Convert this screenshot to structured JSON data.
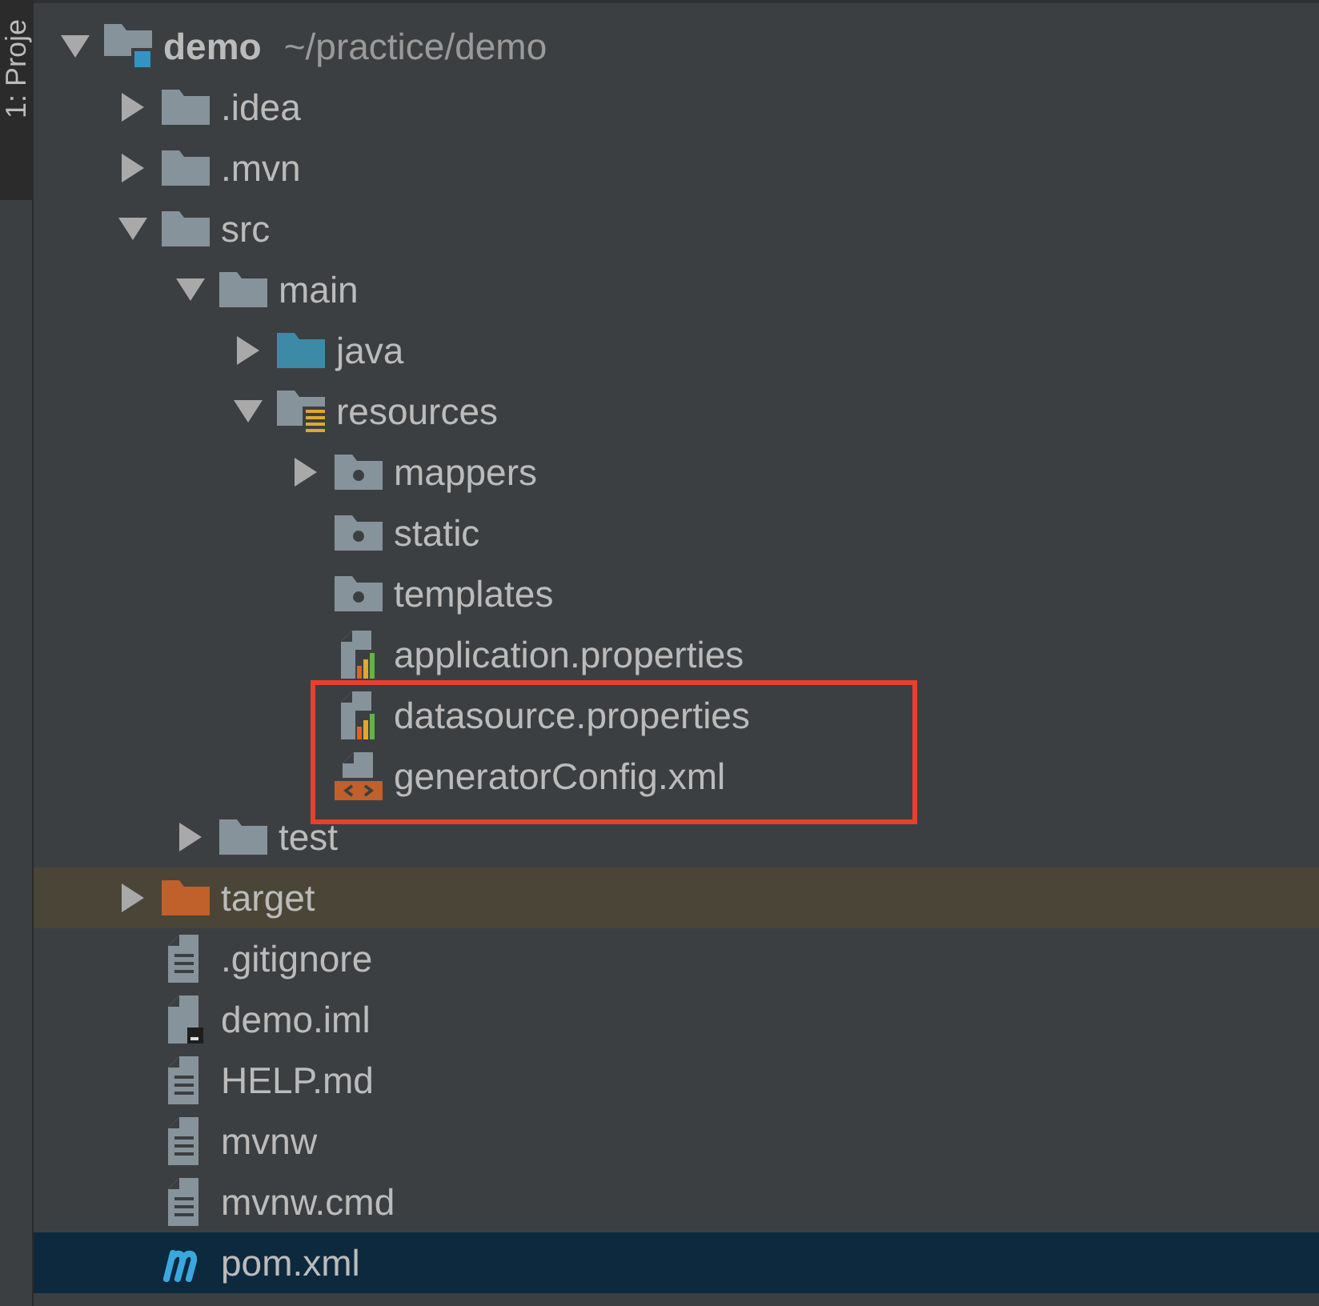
{
  "side_tab": {
    "label": "1: Proje"
  },
  "tree": [
    {
      "name": "demo",
      "path": "~/practice/demo",
      "kind": "project",
      "expanded": true,
      "selected": false,
      "children": [
        {
          "name": ".idea",
          "kind": "folder",
          "expanded": false,
          "selected": false
        },
        {
          "name": ".mvn",
          "kind": "folder",
          "expanded": false,
          "selected": false
        },
        {
          "name": "src",
          "kind": "folder",
          "expanded": true,
          "selected": false,
          "children": [
            {
              "name": "main",
              "kind": "folder",
              "expanded": true,
              "selected": false,
              "children": [
                {
                  "name": "java",
                  "kind": "source",
                  "expanded": false,
                  "selected": false
                },
                {
                  "name": "resources",
                  "kind": "resources",
                  "expanded": true,
                  "selected": false,
                  "children": [
                    {
                      "name": "mappers",
                      "kind": "package",
                      "expanded": false,
                      "selected": false
                    },
                    {
                      "name": "static",
                      "kind": "package",
                      "selected": false
                    },
                    {
                      "name": "templates",
                      "kind": "package",
                      "selected": false
                    },
                    {
                      "name": "application.properties",
                      "kind": "properties",
                      "selected": false
                    },
                    {
                      "name": "datasource.properties",
                      "kind": "properties",
                      "selected": false,
                      "highlighted": true
                    },
                    {
                      "name": "generatorConfig.xml",
                      "kind": "xml",
                      "selected": false,
                      "highlighted": true
                    }
                  ]
                }
              ]
            },
            {
              "name": "test",
              "kind": "folder",
              "expanded": false,
              "selected": false
            }
          ]
        },
        {
          "name": "target",
          "kind": "excluded",
          "expanded": false,
          "selected": false
        },
        {
          "name": ".gitignore",
          "kind": "text",
          "selected": false
        },
        {
          "name": "demo.iml",
          "kind": "module",
          "selected": false
        },
        {
          "name": "HELP.md",
          "kind": "text",
          "selected": false
        },
        {
          "name": "mvnw",
          "kind": "text",
          "selected": false
        },
        {
          "name": "mvnw.cmd",
          "kind": "text",
          "selected": false
        },
        {
          "name": "pom.xml",
          "kind": "maven",
          "selected": true
        }
      ]
    }
  ]
}
